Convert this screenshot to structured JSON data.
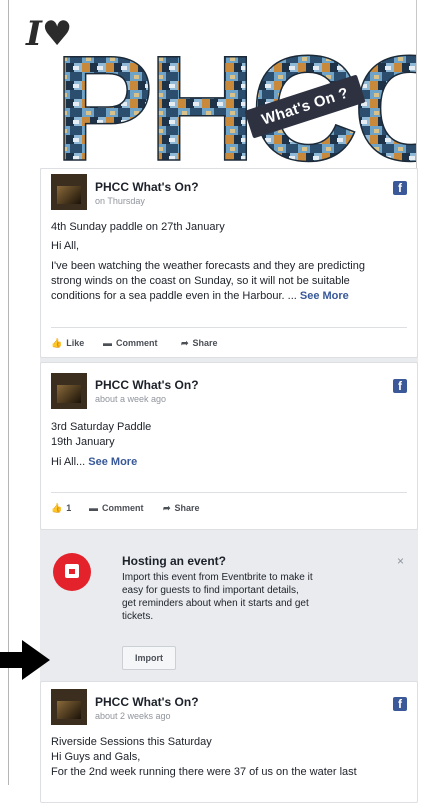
{
  "header": {
    "logo_mark": "I♥",
    "logo_text": "PHCC",
    "tag": "What's On ?"
  },
  "posts": [
    {
      "author": "PHCC What's On?",
      "when": "on Thursday",
      "lines": [
        "4th Sunday paddle on 27th January",
        "Hi All,",
        "I've been watching the weather forecasts and they are predicting",
        "strong winds on the coast on Sunday, so it will not be suitable",
        "conditions for a sea paddle even in the Harbour. ..."
      ],
      "see_more": "See More",
      "actions": [
        "Like",
        "Comment",
        "Share"
      ]
    },
    {
      "author": "PHCC What's On?",
      "when": "about a week ago",
      "lines": [
        "3rd Saturday Paddle",
        "19th January",
        "Hi All..."
      ],
      "see_more": "See More",
      "like_count": "1",
      "actions": [
        "Comment",
        "Share"
      ]
    },
    {
      "author": "PHCC What's On?",
      "when": "about 2 weeks ago",
      "lines": [
        "Riverside Sessions this Saturday",
        "Hi Guys and Gals,",
        "For the 2nd week running there were 37 of us on the water last"
      ]
    }
  ],
  "event_prompt": {
    "title": "Hosting an event?",
    "body": [
      "Import this event from Eventbrite to make it",
      "easy for guests to find important details,",
      "get reminders about when it starts and get",
      "tickets."
    ],
    "button": "Import",
    "close": "×"
  },
  "icons": {
    "facebook": "facebook-icon",
    "like": "thumbs-up-icon",
    "comment": "comment-icon",
    "share": "share-icon",
    "event": "calendar-icon",
    "pointer": "arrow-right-icon"
  },
  "colors": {
    "facebook_blue": "#3b5998",
    "link": "#385898",
    "event_red": "#e4222c",
    "feed_bg": "#e9ebee"
  }
}
